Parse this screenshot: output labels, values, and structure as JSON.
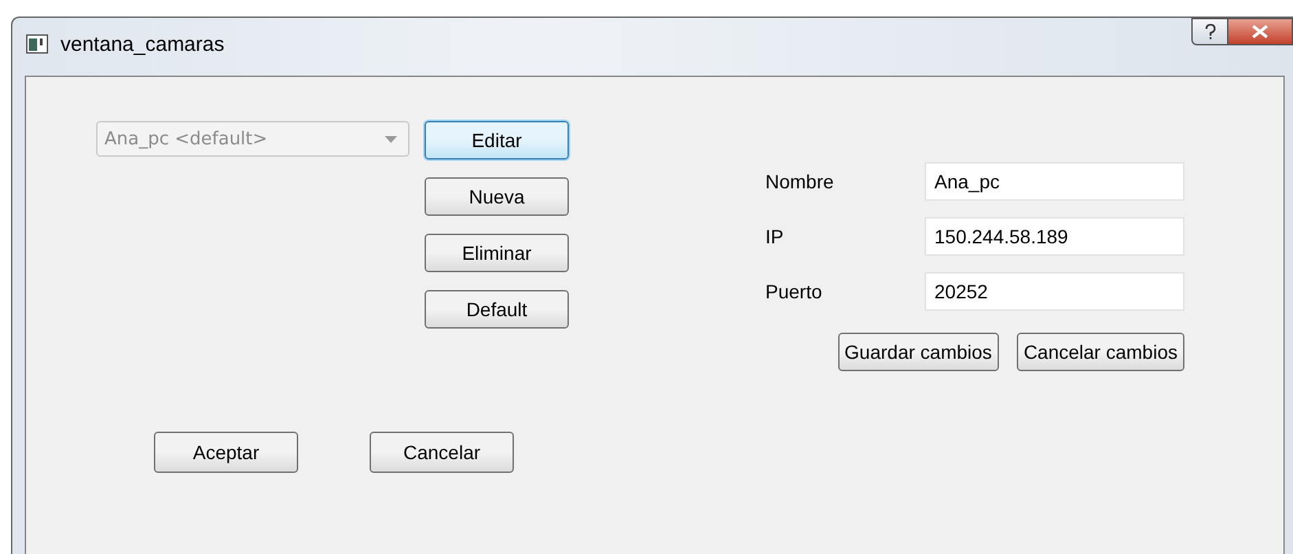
{
  "window": {
    "title": "ventana_camaras"
  },
  "camera_select": {
    "value": "Ana_pc <default>",
    "disabled": true
  },
  "camera_buttons": [
    {
      "label": "Editar",
      "focused": true
    },
    {
      "label": "Nueva",
      "focused": false
    },
    {
      "label": "Eliminar",
      "focused": false
    },
    {
      "label": "Default",
      "focused": false
    }
  ],
  "form": {
    "fields": [
      {
        "label": "Nombre",
        "value": "Ana_pc"
      },
      {
        "label": "IP",
        "value": "150.244.58.189"
      },
      {
        "label": "Puerto",
        "value": "20252"
      }
    ],
    "buttons": [
      "Guardar cambios",
      "Cancelar cambios"
    ]
  },
  "dialog_buttons": [
    "Aceptar",
    "Cancelar"
  ]
}
